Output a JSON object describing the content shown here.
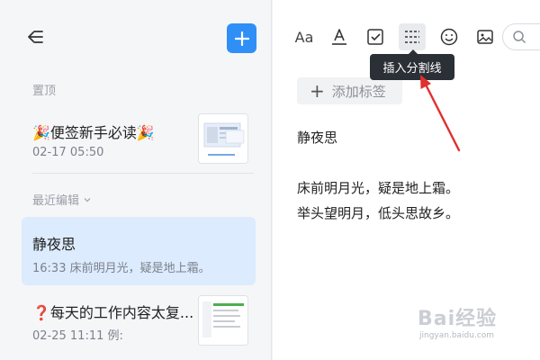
{
  "sidebar": {
    "pinned_label": "置顶",
    "recent_label": "最近编辑",
    "notes": [
      {
        "title": "🎉便签新手必读🎉",
        "meta": "02-17 05:50"
      },
      {
        "title": "静夜思",
        "meta": "16:33 床前明月光，疑是地上霜。"
      },
      {
        "title": "❓每天的工作内容太复...",
        "meta": "02-25 11:11 例:"
      }
    ]
  },
  "toolbar": {
    "font_glyph": "Aa",
    "tooltip": "插入分割线"
  },
  "editor": {
    "tag_button": "添加标签",
    "heading": "静夜思",
    "lines": [
      "床前明月光，疑是地上霜。",
      "举头望明月，低头思故乡。"
    ]
  },
  "watermark": {
    "text": "Bai经验",
    "url": "jingyan.baidu.com"
  },
  "colors": {
    "accent": "#2f8ff7",
    "selected_note_bg": "#dcebfd",
    "arrow": "#e0302f"
  }
}
